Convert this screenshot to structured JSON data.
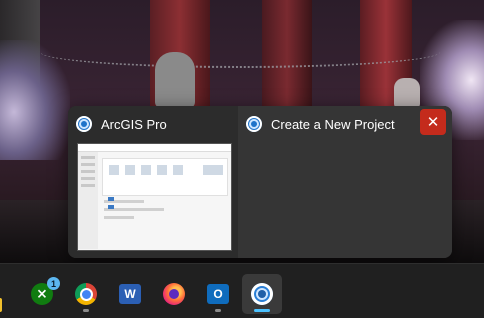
{
  "preview": {
    "window_left_title": "ArcGIS Pro",
    "window_right_title": "Create a New Project",
    "close_glyph": "✕",
    "app_icon": "arcgis-pro-icon"
  },
  "taskbar": {
    "items": [
      {
        "name": "file-explorer",
        "icon": "folder-icon"
      },
      {
        "name": "xbox",
        "icon": "xbox-icon",
        "glyph": "⨯",
        "badge": "1"
      },
      {
        "name": "chrome",
        "icon": "chrome-icon"
      },
      {
        "name": "word",
        "icon": "word-icon",
        "glyph": "W"
      },
      {
        "name": "firefox",
        "icon": "firefox-icon"
      },
      {
        "name": "outlook",
        "icon": "outlook-icon",
        "glyph": "O"
      },
      {
        "name": "arcgis-pro",
        "icon": "arcgis-pro-icon",
        "active": true
      }
    ]
  },
  "colors": {
    "accent": "#4cc2ff",
    "close_red": "#c42b1c",
    "taskbar": "#202020",
    "preview_bg": "#2c2c2c"
  }
}
